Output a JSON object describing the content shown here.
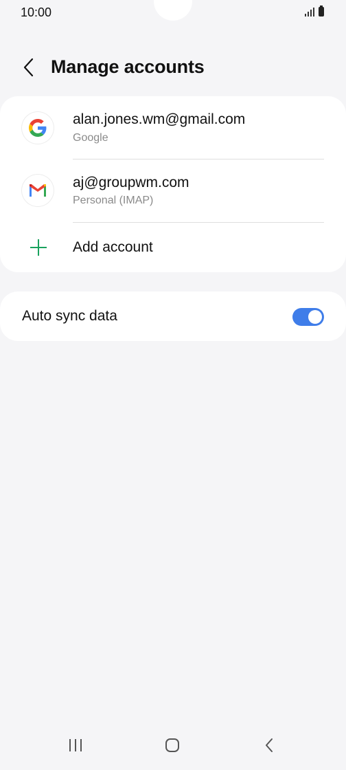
{
  "status_bar": {
    "time": "10:00"
  },
  "header": {
    "title": "Manage accounts",
    "back_icon": "chevron-left-icon"
  },
  "accounts": [
    {
      "email": "alan.jones.wm@gmail.com",
      "type": "Google",
      "icon": "google-icon"
    },
    {
      "email": "aj@groupwm.com",
      "type": "Personal (IMAP)",
      "icon": "gmail-icon"
    }
  ],
  "add_account": {
    "label": "Add account",
    "icon": "plus-icon",
    "icon_color": "#1aa25e"
  },
  "auto_sync": {
    "label": "Auto sync data",
    "enabled": true,
    "toggle_color": "#3f7de9"
  },
  "nav_bar": {
    "items": [
      "recent-apps-icon",
      "home-icon",
      "back-icon"
    ]
  },
  "colors": {
    "background": "#f5f5f7",
    "card": "#ffffff",
    "secondary_text": "#8a8a8a"
  }
}
